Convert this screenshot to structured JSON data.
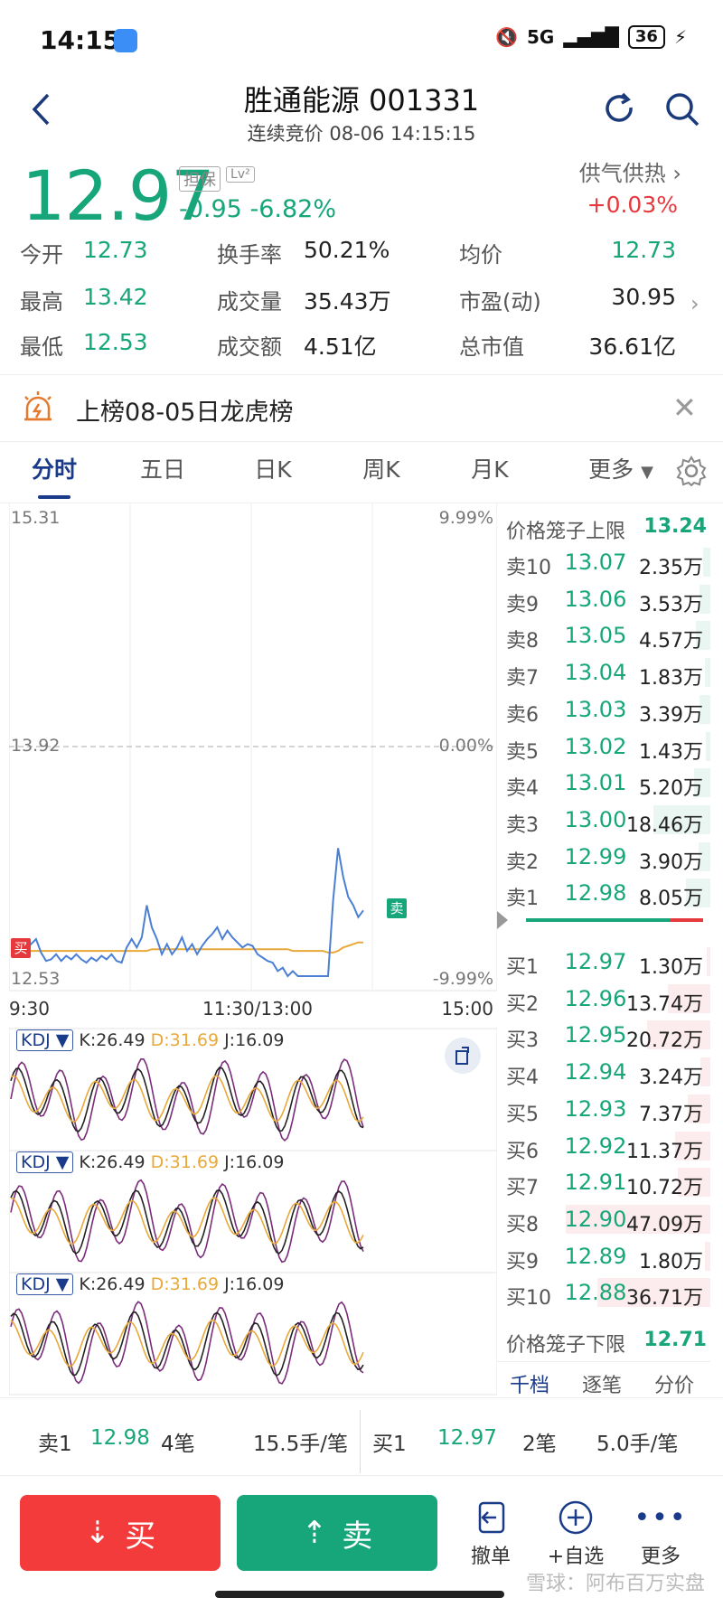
{
  "status_bar": {
    "time": "14:15",
    "network": "5G",
    "battery": "36"
  },
  "header": {
    "title": "胜通能源 001331",
    "subtitle": "连续竞价 08-06 14:15:15"
  },
  "quote": {
    "price": "12.97",
    "tag_margin": "担保",
    "tag_level": "Lv²",
    "change": "-0.95",
    "change_pct": "-6.82%",
    "supply_label": "供气供热",
    "supply_change": "+0.03%"
  },
  "stats": [
    {
      "label": "今开",
      "value": "12.73"
    },
    {
      "label": "换手率",
      "value": "50.21%"
    },
    {
      "label": "均价",
      "value": "12.73"
    },
    {
      "label": "最高",
      "value": "13.42"
    },
    {
      "label": "成交量",
      "value": "35.43万"
    },
    {
      "label": "市盈(动)",
      "value": "30.95"
    },
    {
      "label": "最低",
      "value": "12.53"
    },
    {
      "label": "成交额",
      "value": "4.51亿"
    },
    {
      "label": "总市值",
      "value": "36.61亿"
    }
  ],
  "banner": {
    "text": "上榜08-05日龙虎榜"
  },
  "tabs": [
    "分时",
    "五日",
    "日K",
    "周K",
    "月K",
    "更多"
  ],
  "chart": {
    "y_top": "15.31",
    "y_mid": "13.92",
    "y_bottom": "12.53",
    "pct_top": "9.99%",
    "pct_mid": "0.00%",
    "pct_bottom": "-9.99%",
    "x_start": "9:30",
    "x_mid": "11:30/13:00",
    "x_end": "15:00",
    "buy_marker": "买",
    "sell_marker": "卖"
  },
  "chart_data": {
    "type": "line",
    "series": [
      {
        "values": [
          12.69,
          12.7,
          12.71,
          12.69,
          12.72,
          12.75,
          12.67,
          12.62,
          12.63,
          12.66,
          12.62,
          12.65,
          12.63,
          12.66,
          12.63,
          12.61,
          12.64,
          12.62,
          12.65,
          12.63,
          12.66,
          12.62,
          12.61,
          12.7,
          12.75,
          12.7,
          12.76,
          12.95,
          12.82,
          12.75,
          12.66,
          12.72,
          12.66,
          12.7,
          12.76,
          12.68,
          12.72,
          12.66,
          12.71,
          12.75,
          12.78,
          12.82,
          12.75,
          12.8,
          12.76,
          12.73,
          12.7,
          12.72,
          12.71,
          12.66,
          12.64,
          12.62,
          12.61,
          12.56,
          12.58,
          12.53,
          12.56,
          12.53,
          12.53,
          12.53,
          12.53,
          12.53,
          12.53,
          12.53,
          12.98,
          13.29,
          13.12,
          13.0,
          12.95,
          12.88,
          12.92
        ]
      },
      {
        "values": [
          12.69,
          12.69,
          12.69,
          12.68,
          12.68,
          12.68,
          12.68,
          12.68,
          12.68,
          12.68,
          12.68,
          12.68,
          12.68,
          12.68,
          12.68,
          12.68,
          12.68,
          12.68,
          12.68,
          12.68,
          12.68,
          12.68,
          12.68,
          12.68,
          12.68,
          12.68,
          12.68,
          12.68,
          12.69,
          12.69,
          12.69,
          12.69,
          12.69,
          12.69,
          12.69,
          12.69,
          12.69,
          12.69,
          12.69,
          12.69,
          12.69,
          12.69,
          12.69,
          12.69,
          12.69,
          12.69,
          12.69,
          12.69,
          12.69,
          12.69,
          12.69,
          12.69,
          12.69,
          12.69,
          12.69,
          12.69,
          12.68,
          12.68,
          12.68,
          12.68,
          12.68,
          12.68,
          12.68,
          12.67,
          12.67,
          12.68,
          12.7,
          12.71,
          12.72,
          12.73,
          12.73
        ]
      }
    ],
    "ylim": [
      12.53,
      15.31
    ]
  },
  "kdj": [
    {
      "label": "KDJ",
      "k": "K:26.49",
      "d": "D:31.69",
      "j": "J:16.09"
    },
    {
      "label": "KDJ",
      "k": "K:26.49",
      "d": "D:31.69",
      "j": "J:16.09"
    },
    {
      "label": "KDJ",
      "k": "K:26.49",
      "d": "D:31.69",
      "j": "J:16.09"
    }
  ],
  "orderbook": {
    "upper_label": "价格笼子上限",
    "upper_value": "13.24",
    "lower_label": "价格笼子下限",
    "lower_value": "12.71",
    "asks": [
      {
        "label": "卖10",
        "price": "13.07",
        "vol": "2.35万"
      },
      {
        "label": "卖9",
        "price": "13.06",
        "vol": "3.53万"
      },
      {
        "label": "卖8",
        "price": "13.05",
        "vol": "4.57万"
      },
      {
        "label": "卖7",
        "price": "13.04",
        "vol": "1.83万"
      },
      {
        "label": "卖6",
        "price": "13.03",
        "vol": "3.39万"
      },
      {
        "label": "卖5",
        "price": "13.02",
        "vol": "1.43万"
      },
      {
        "label": "卖4",
        "price": "13.01",
        "vol": "5.20万"
      },
      {
        "label": "卖3",
        "price": "13.00",
        "vol": "18.46万"
      },
      {
        "label": "卖2",
        "price": "12.99",
        "vol": "3.90万"
      },
      {
        "label": "卖1",
        "price": "12.98",
        "vol": "8.05万"
      }
    ],
    "bids": [
      {
        "label": "买1",
        "price": "12.97",
        "vol": "1.30万"
      },
      {
        "label": "买2",
        "price": "12.96",
        "vol": "13.74万"
      },
      {
        "label": "买3",
        "price": "12.95",
        "vol": "20.72万"
      },
      {
        "label": "买4",
        "price": "12.94",
        "vol": "3.24万"
      },
      {
        "label": "买5",
        "price": "12.93",
        "vol": "7.37万"
      },
      {
        "label": "买6",
        "price": "12.92",
        "vol": "11.37万"
      },
      {
        "label": "买7",
        "price": "12.91",
        "vol": "10.72万"
      },
      {
        "label": "买8",
        "price": "12.90",
        "vol": "47.09万"
      },
      {
        "label": "买9",
        "price": "12.89",
        "vol": "1.80万"
      },
      {
        "label": "买10",
        "price": "12.88",
        "vol": "36.71万"
      }
    ],
    "tabs": [
      "千档",
      "逐笔",
      "分价"
    ]
  },
  "ticker": {
    "sell_label": "卖1",
    "sell_price": "12.98",
    "sell_count": "4笔",
    "sell_avg": "15.5手/笔",
    "buy_label": "买1",
    "buy_price": "12.97",
    "buy_count": "2笔",
    "buy_avg": "5.0手/笔"
  },
  "actions": {
    "buy": "买",
    "sell": "卖",
    "cancel": "撤单",
    "watchlist": "+自选",
    "more": "更多"
  },
  "watermark": "雪球：阿布百万实盘",
  "colors": {
    "down": "#17a67a",
    "up": "#e6393d",
    "price_line": "#4a7fd4",
    "avg_line": "#e8a93a"
  }
}
